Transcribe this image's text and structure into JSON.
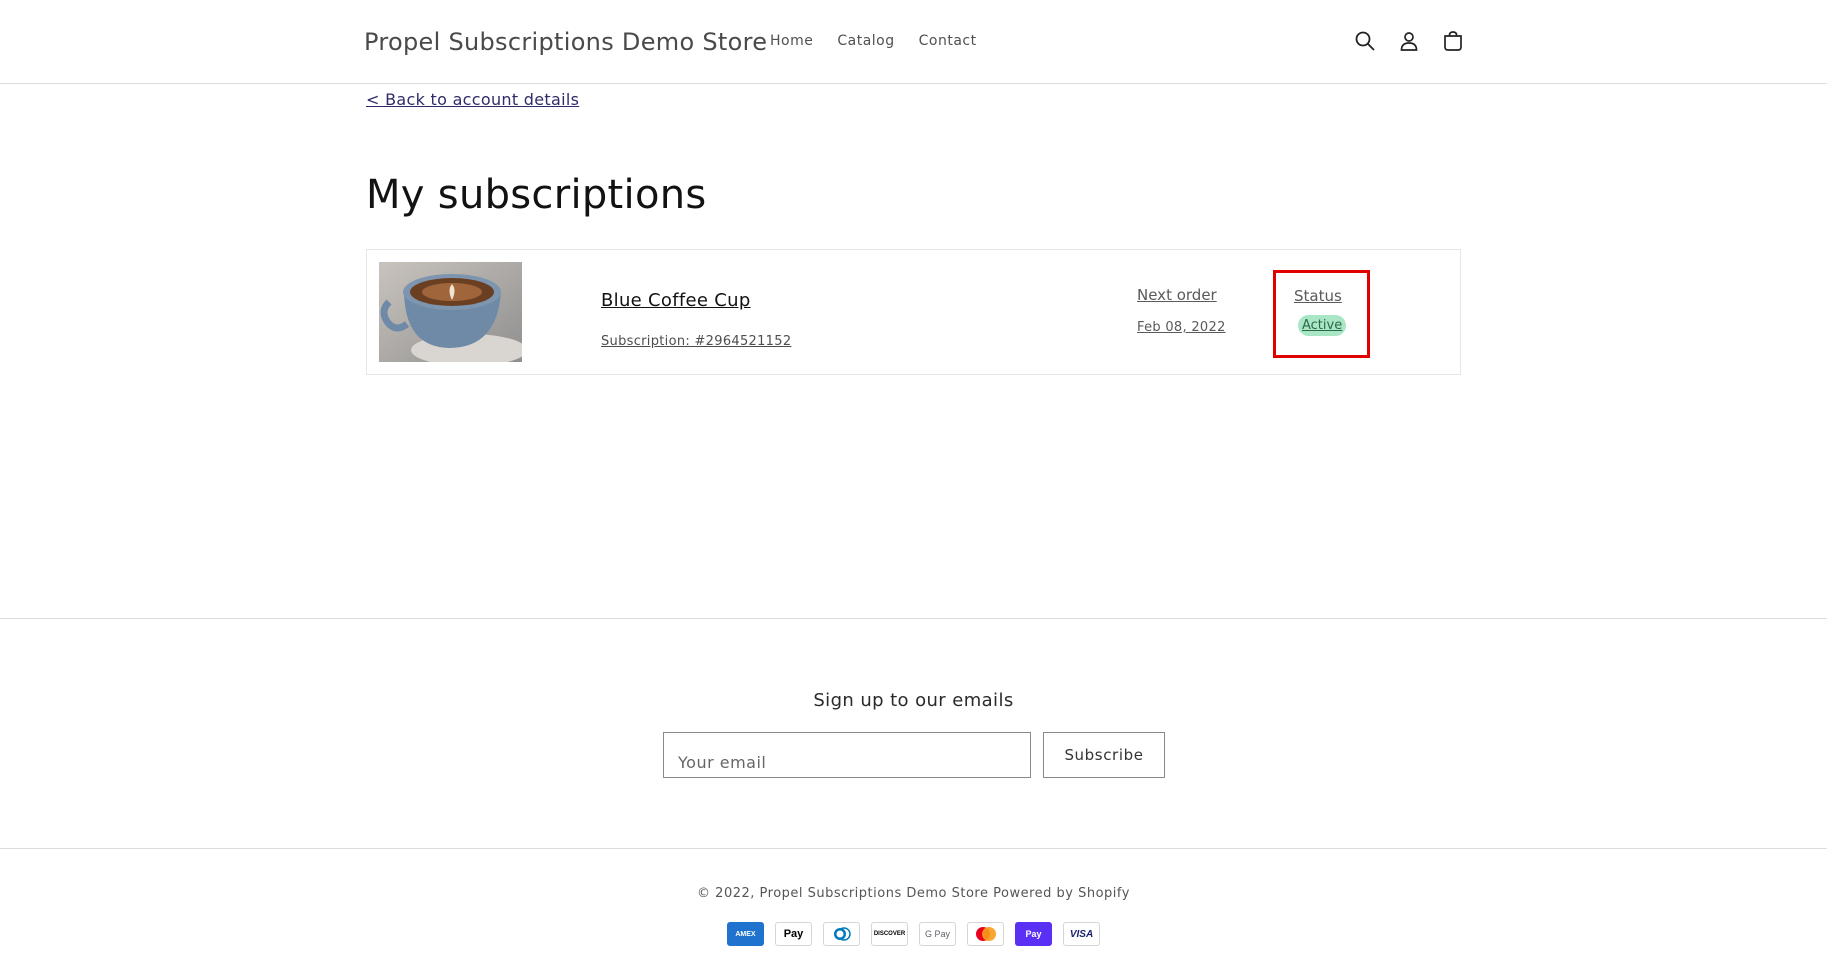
{
  "header": {
    "store_name": "Propel Subscriptions Demo Store",
    "nav": [
      {
        "label": "Home"
      },
      {
        "label": "Catalog"
      },
      {
        "label": "Contact"
      }
    ],
    "icons": [
      "search-icon",
      "account-icon",
      "cart-icon"
    ]
  },
  "main": {
    "back_link": "< Back to account details",
    "title": "My subscriptions",
    "subscription": {
      "product_name": "Blue Coffee Cup",
      "subscription_number": "Subscription: #2964521152",
      "next_order_label": "Next order",
      "next_order_date": "Feb 08, 2022",
      "status_label": "Status",
      "status_value": "Active"
    }
  },
  "footer": {
    "signup_title": "Sign up to our emails",
    "email_placeholder": "Your email",
    "subscribe_label": "Subscribe",
    "copyright_prefix": "© 2022,",
    "copyright_store": "Propel Subscriptions Demo Store",
    "powered_by": "Powered by Shopify",
    "payments": [
      {
        "label": "AMEX",
        "bg": "#1f72cd",
        "fg": "#ffffff"
      },
      {
        "label": "Pay",
        "bg": "#ffffff",
        "fg": "#000000"
      },
      {
        "label": "D",
        "bg": "#ffffff",
        "fg": "#0079be"
      },
      {
        "label": "DISCOVER",
        "bg": "#ffffff",
        "fg": "#000000"
      },
      {
        "label": "G Pay",
        "bg": "#ffffff",
        "fg": "#5f6368"
      },
      {
        "label": "",
        "bg": "#ffffff",
        "fg": "#000000"
      },
      {
        "label": "Pay",
        "bg": "#5a31f4",
        "fg": "#ffffff"
      },
      {
        "label": "VISA",
        "bg": "#ffffff",
        "fg": "#1a1f71"
      }
    ]
  },
  "colors": {
    "status_badge": "#a8e6c6",
    "highlight_box": "#e00000",
    "back_link": "#2f2b6a"
  }
}
